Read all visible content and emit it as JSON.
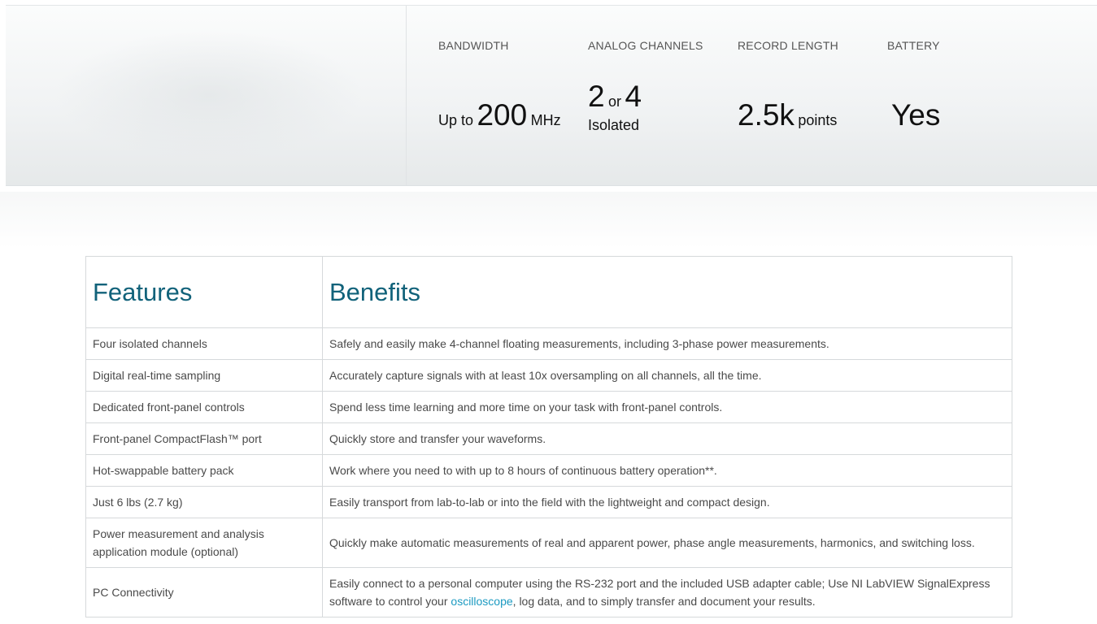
{
  "specs": {
    "bandwidth": {
      "label": "BANDWIDTH",
      "prefix": "Up to",
      "value": "200",
      "unit": "MHz"
    },
    "analog_channels": {
      "label": "ANALOG CHANNELS",
      "value_a": "2",
      "conjunction": "or",
      "value_b": "4",
      "note": "Isolated"
    },
    "record_length": {
      "label": "RECORD LENGTH",
      "value": "2.5k",
      "unit": "points"
    },
    "battery": {
      "label": "BATTERY",
      "value": "Yes"
    }
  },
  "table": {
    "headers": [
      "Features",
      "Benefits"
    ],
    "rows": [
      {
        "feature": "Four isolated channels",
        "benefit": "Safely and easily make 4-channel floating measurements, including 3-phase power measurements."
      },
      {
        "feature": "Digital real-time sampling",
        "benefit": "Accurately capture signals with at least 10x oversampling on all channels, all the time."
      },
      {
        "feature": "Dedicated front-panel controls",
        "benefit": "Spend less time learning and more time on your task with front-panel controls."
      },
      {
        "feature": "Front-panel CompactFlash™ port",
        "benefit": "Quickly store and transfer your waveforms."
      },
      {
        "feature": "Hot-swappable battery pack",
        "benefit": "Work where you need to with up to 8 hours of continuous battery operation**."
      },
      {
        "feature": "Just 6 lbs (2.7 kg)",
        "benefit": "Easily transport from lab-to-lab or into the field with the lightweight and compact design."
      },
      {
        "feature": "Power measurement and analysis application module (optional)",
        "benefit": "Quickly make automatic measurements of real and apparent power, phase angle measurements, harmonics, and switching loss."
      },
      {
        "feature": "PC Connectivity",
        "benefit_before": "Easily connect to a personal computer using the RS-232 port and the included USB adapter cable; Use NI LabVIEW SignalExpress software to control your ",
        "benefit_link": "oscilloscope",
        "benefit_after": ", log data, and to simply transfer and document your results."
      }
    ]
  },
  "colors": {
    "heading": "#11627a",
    "link": "#1c9ac1",
    "border": "#d6d9db"
  }
}
